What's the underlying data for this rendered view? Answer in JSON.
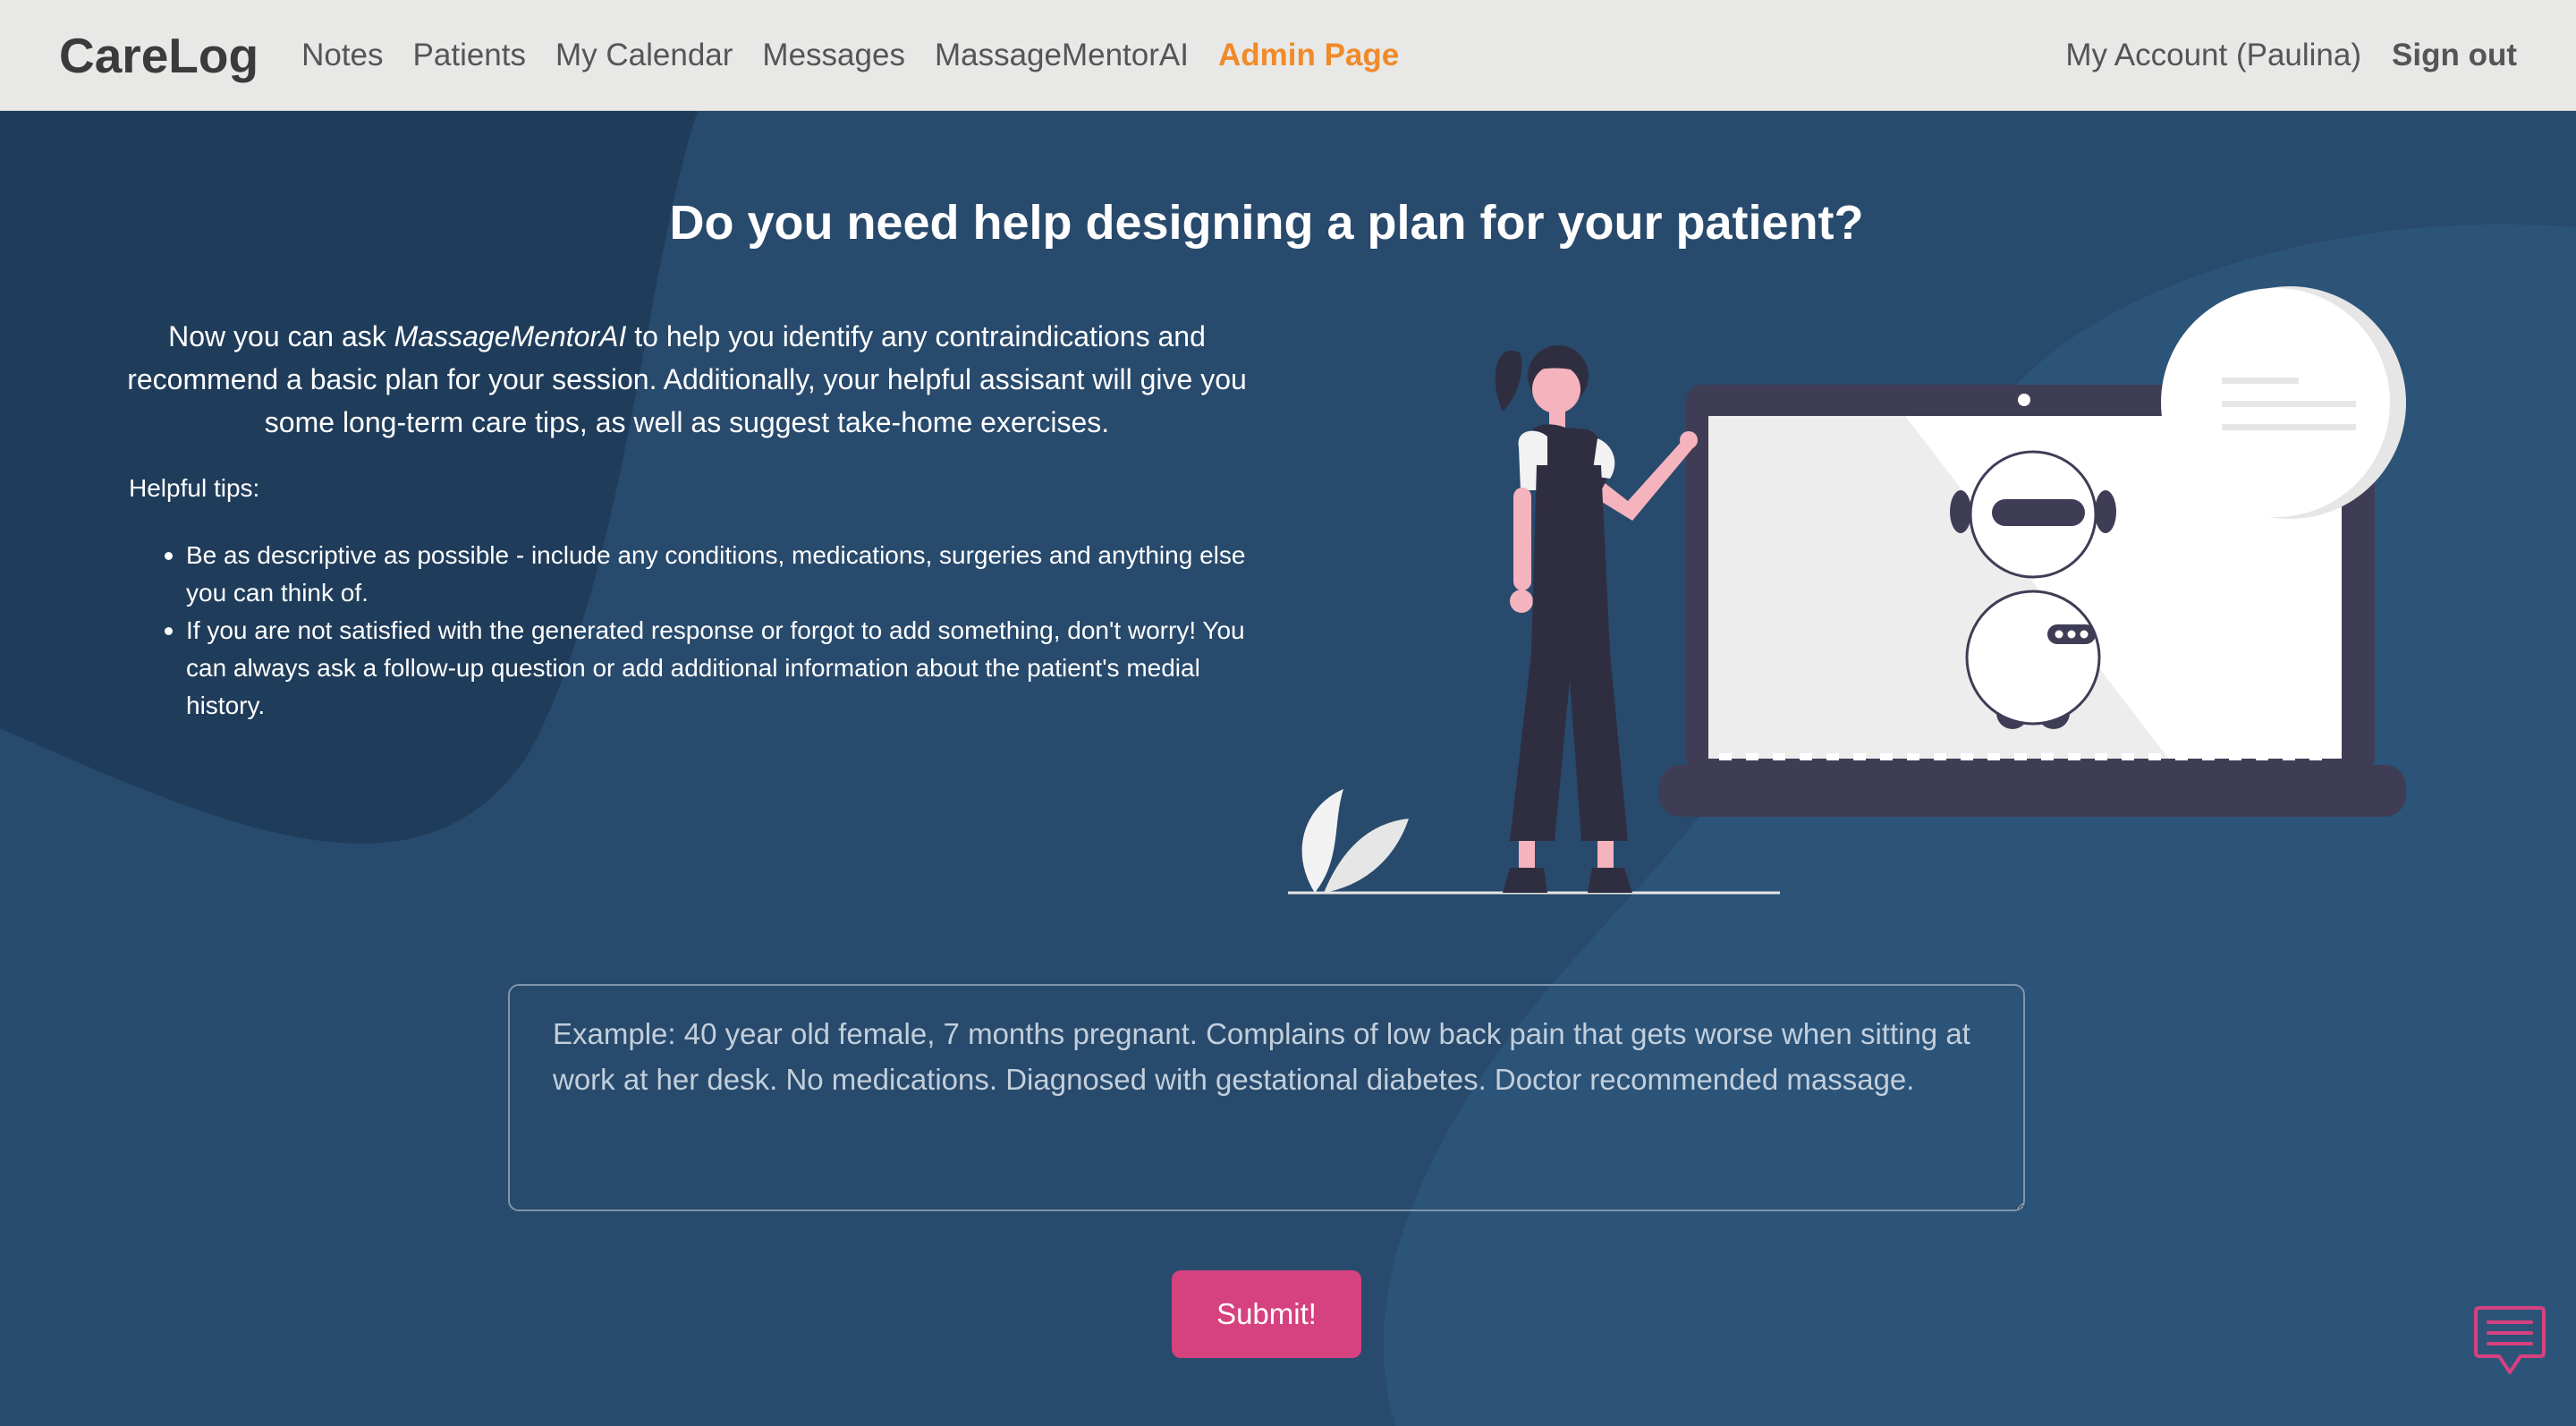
{
  "navbar": {
    "brand": "CareLog",
    "links": [
      {
        "label": "Notes"
      },
      {
        "label": "Patients"
      },
      {
        "label": "My Calendar"
      },
      {
        "label": "Messages"
      },
      {
        "label": "MassageMentorAI"
      },
      {
        "label": "Admin Page"
      }
    ],
    "account": "My Account (Paulina)",
    "signout": "Sign out"
  },
  "hero": {
    "headline": "Do you need help designing a plan for your patient?",
    "intro_before": "Now you can ask ",
    "intro_name": "MassageMentorAI",
    "intro_after": " to help you identify any contraindications and recommend a basic plan for your session. Additionally, your helpful assisant will give you some long-term care tips, as well as suggest take-home exercises.",
    "tips_heading": "Helpful tips:",
    "tips": [
      "Be as descriptive as possible - include any conditions, medications, surgeries and anything else you can think of.",
      "If you are not satisfied with the generated response or forgot to add something, don't worry! You can always ask a follow-up question or add additional information about the patient's medial history."
    ]
  },
  "form": {
    "placeholder": "Example: 40 year old female, 7 months pregnant. Complains of low back pain that gets worse when sitting at work at her desk. No medications. Diagnosed with gestational diabetes. Doctor recommended massage.",
    "submit_label": "Submit!"
  },
  "colors": {
    "accent": "#d6417f",
    "admin_link": "#f08a2a",
    "background": "#284a6c",
    "navbar": "#e8e8e7"
  },
  "icons": {
    "chat": "chat-bubble-icon",
    "illustration": "woman-presenting-chatbot-illustration"
  }
}
